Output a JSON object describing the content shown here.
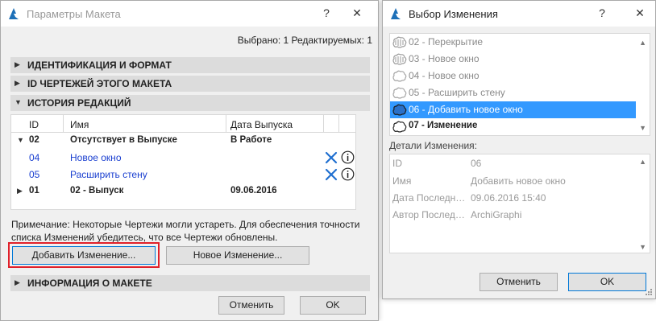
{
  "window1": {
    "title": "Параметры Макета",
    "help": "?",
    "close": "✕",
    "selected_info": "Выбрано: 1 Редактируемых: 1",
    "sections": {
      "ident": "ИДЕНТИФИКАЦИЯ И ФОРМАТ",
      "drawings": "ID ЧЕРТЕЖЕЙ ЭТОГО МАКЕТА",
      "history": "ИСТОРИЯ РЕДАКЦИЙ",
      "info": "ИНФОРМАЦИЯ О МАКЕТЕ"
    },
    "table": {
      "headers": {
        "id": "ID",
        "name": "Имя",
        "date": "Дата Выпуска"
      },
      "rows": [
        {
          "id": "02",
          "name": "Отсутствует в Выпуске",
          "date": "В Работе"
        },
        {
          "id": "04",
          "name": "Новое окно"
        },
        {
          "id": "05",
          "name": "Расширить стену"
        },
        {
          "id": "01",
          "name": "02 - Выпуск",
          "date": "09.06.2016"
        }
      ]
    },
    "note_line1": "Примечание: Некоторые Чертежи могли устареть. Для обеспечения точности",
    "note_line2": "списка Изменений убедитесь, что все Чертежи обновлены.",
    "add_change_button": "Добавить Изменение...",
    "new_change_button": "Новое Изменение...",
    "cancel_button": "Отменить",
    "ok_button": "OK"
  },
  "window2": {
    "title": "Выбор Изменения",
    "help": "?",
    "close": "✕",
    "items": [
      {
        "label": "02 - Перекрытие"
      },
      {
        "label": "03 - Новое окно"
      },
      {
        "label": "04 - Новое окно"
      },
      {
        "label": "05 - Расширить стену"
      },
      {
        "label": "06 - Добавить новое окно"
      },
      {
        "label": "07 - Изменение"
      }
    ],
    "details_label": "Детали Изменения:",
    "details": [
      {
        "key": "ID",
        "value": "06"
      },
      {
        "key": "Имя",
        "value": "Добавить новое окно"
      },
      {
        "key": "Дата Последнего Изменения",
        "value": "09.06.2016 15:40"
      },
      {
        "key": "Автор Последнего Изменения",
        "value": "ArchiGraphi"
      }
    ],
    "cancel_button": "Отменить",
    "ok_button": "OK"
  },
  "colors": {
    "selection": "#3399ff",
    "link_blue": "#1a3fd0",
    "focus_red": "#e0202a",
    "x_icon_blue": "#1f6fd0"
  }
}
